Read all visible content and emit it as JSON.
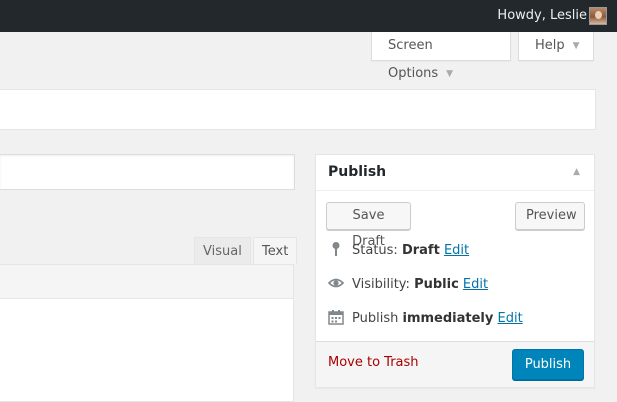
{
  "adminbar": {
    "greeting": "Howdy, Leslie"
  },
  "header": {
    "screen_options_label": "Screen Options",
    "help_label": "Help"
  },
  "editor": {
    "tabs": [
      {
        "label": "Visual"
      },
      {
        "label": "Text"
      }
    ]
  },
  "publish": {
    "title": "Publish",
    "save_draft_label": "Save Draft",
    "preview_label": "Preview",
    "status": {
      "label": "Status:",
      "value": "Draft",
      "edit": "Edit"
    },
    "visibility": {
      "label": "Visibility:",
      "value": "Public",
      "edit": "Edit"
    },
    "schedule": {
      "label": "Publish",
      "value": "immediately",
      "edit": "Edit"
    },
    "trash_label": "Move to Trash",
    "publish_label": "Publish"
  },
  "colors": {
    "adminbar": "#23282d",
    "link": "#0073aa",
    "primary_button": "#0085ba",
    "trash": "#aa0000"
  }
}
